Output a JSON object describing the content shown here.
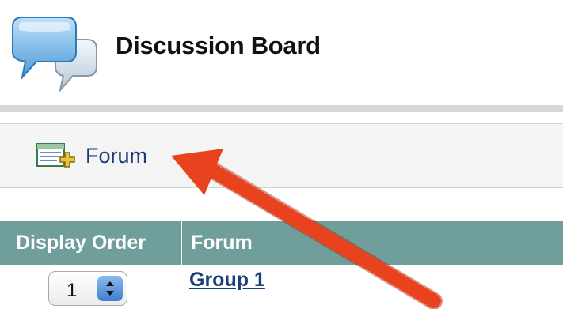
{
  "header": {
    "title": "Discussion Board",
    "icon": "speech-bubbles-icon"
  },
  "action_bar": {
    "forum_label": "Forum",
    "forum_icon": "add-forum-icon"
  },
  "table": {
    "columns": [
      "Display Order",
      "Forum"
    ],
    "rows": [
      {
        "display_order": "1",
        "forum": "Group 1"
      }
    ]
  },
  "colors": {
    "header_background": "#709e9a",
    "link": "#1d3f7c",
    "annotation_arrow": "#e8431e"
  }
}
